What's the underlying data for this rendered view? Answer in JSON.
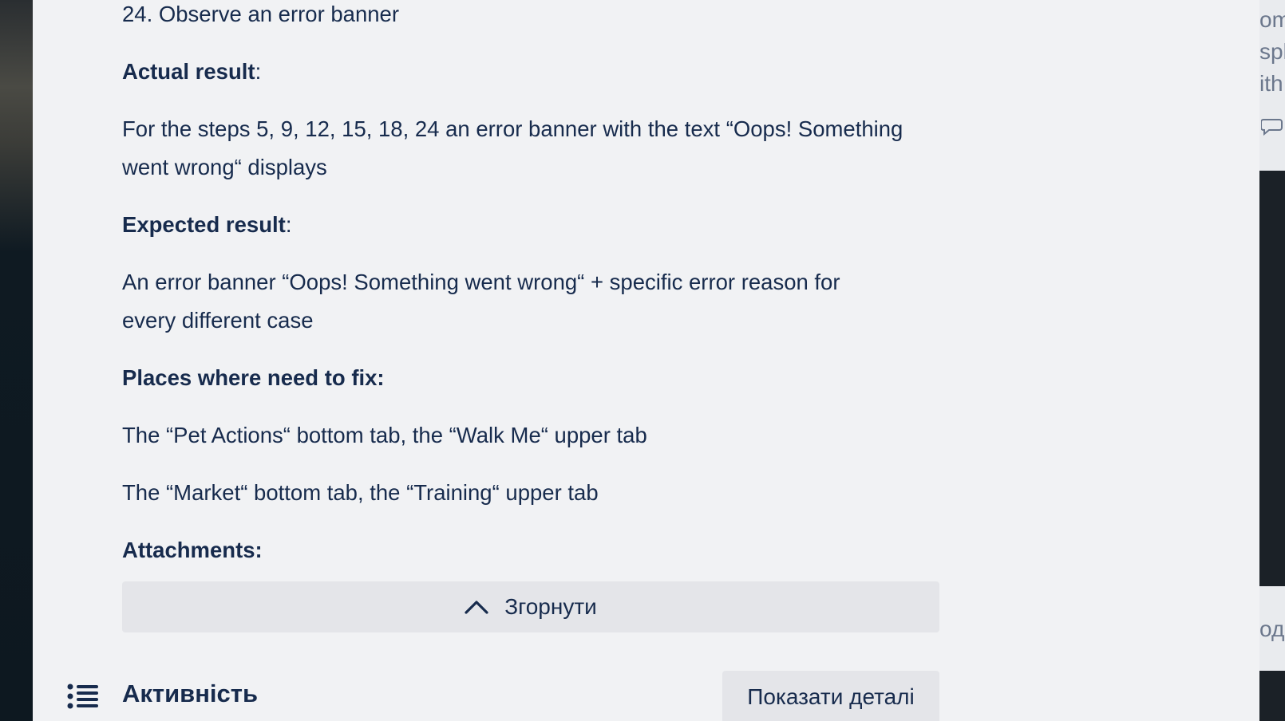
{
  "description": {
    "step_24": "24. Observe an error banner",
    "actual_heading": "Actual result",
    "actual_colon": ":",
    "actual_line1": "For the steps 5, 9, 12, 15, 18, 24 an error banner with the text “Oops! Something",
    "actual_line2": "went wrong“ displays",
    "expected_heading": "Expected result",
    "expected_colon": ":",
    "expected_line1": "An error banner “Oops! Something went wrong“ + specific error reason for",
    "expected_line2": "every different case",
    "places_heading": "Places where need to fix:",
    "place_1": "The “Pet Actions“ bottom tab, the “Walk Me“ upper tab",
    "place_2": "The “Market“ bottom tab, the “Training“ upper tab",
    "attachments_heading": "Attachments:"
  },
  "collapse_button": {
    "label": "Згорнути",
    "icon": "chevron-up-icon"
  },
  "activity": {
    "title": "Активність",
    "icon": "list-icon",
    "show_details_label": "Показати деталі"
  },
  "background_right": {
    "fragment_1": "om",
    "fragment_2": "spl",
    "fragment_3": "ith",
    "fragment_4": "ода"
  },
  "colors": {
    "modal_bg": "#f1f2f4",
    "text": "#172b4d",
    "button_bg": "#e4e5e9"
  }
}
